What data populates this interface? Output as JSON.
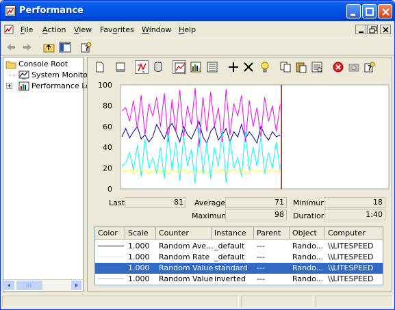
{
  "window": {
    "title": "Performance"
  },
  "menu": {
    "items": [
      {
        "key": "F",
        "rest": "ile"
      },
      {
        "key": "A",
        "rest": "ction"
      },
      {
        "key": "V",
        "rest": "iew"
      },
      {
        "pre": "Fav",
        "key": "o",
        "rest": "rites"
      },
      {
        "key": "W",
        "rest": "indow"
      },
      {
        "key": "H",
        "rest": "elp"
      }
    ]
  },
  "tree": {
    "root": "Console Root",
    "items": [
      "System Monitor",
      "Performance Lo"
    ]
  },
  "stats": {
    "last_label": "Last",
    "last_value": "81",
    "average_label": "Average",
    "average_value": "71",
    "minimum_label": "Minimum",
    "minimum_value": "18",
    "maximum_label": "Maximum",
    "maximum_value": "98",
    "duration_label": "Duration",
    "duration_value": "1:40"
  },
  "counters": {
    "columns": [
      "Color",
      "Scale",
      "Counter",
      "Instance",
      "Parent",
      "Object",
      "Computer"
    ],
    "rows": [
      {
        "color": "#0000a0",
        "scale": "1.000",
        "counter": "Random Ave...",
        "instance": "_default",
        "parent": "---",
        "object": "Rando...",
        "computer": "\\\\LITESPEED",
        "selected": false
      },
      {
        "color": "#ffff00",
        "scale": "1.000",
        "counter": "Random Rate",
        "instance": "_default",
        "parent": "---",
        "object": "Rando...",
        "computer": "\\\\LITESPEED",
        "selected": false
      },
      {
        "color": "#ff00ff",
        "scale": "1.000",
        "counter": "Random Value",
        "instance": "standard",
        "parent": "---",
        "object": "Rando...",
        "computer": "\\\\LITESPEED",
        "selected": true
      },
      {
        "color": "#00ffff",
        "scale": "1.000",
        "counter": "Random Value",
        "instance": "inverted",
        "parent": "---",
        "object": "Rando...",
        "computer": "\\\\LITESPEED",
        "selected": false
      }
    ]
  },
  "chart_data": {
    "type": "line",
    "ylim": [
      0,
      100
    ],
    "yticks": [
      "100",
      "80",
      "60",
      "40",
      "20",
      "0"
    ],
    "grid": false,
    "time_bar_fraction": 0.6,
    "series": [
      {
        "counter": "Random Ave...",
        "color": "#0000a0",
        "values": [
          50,
          58,
          49,
          55,
          60,
          48,
          52,
          45,
          50,
          62,
          55,
          48,
          58,
          63,
          55,
          45,
          60,
          52,
          48,
          56,
          65,
          50,
          44,
          55,
          60,
          47,
          52,
          58,
          45,
          55,
          50,
          62,
          48,
          55,
          50,
          44,
          60,
          52,
          47,
          55,
          50,
          52
        ]
      },
      {
        "counter": "Random Rate",
        "color": "#ffff00",
        "values": [
          18,
          16,
          19,
          15,
          18,
          16,
          18,
          15,
          17,
          19,
          16,
          18,
          15,
          18,
          17,
          16,
          19,
          15,
          17,
          18,
          16,
          18,
          15,
          17,
          18,
          16,
          19,
          15,
          17,
          18,
          16,
          18,
          15,
          17,
          18,
          16,
          18,
          15,
          17,
          18,
          16,
          17
        ]
      },
      {
        "counter": "Random Value",
        "instance": "standard",
        "color": "#ff00ff",
        "values": [
          75,
          78,
          65,
          85,
          58,
          90,
          52,
          82,
          70,
          88,
          60,
          92,
          45,
          86,
          55,
          95,
          50,
          80,
          62,
          97,
          40,
          88,
          55,
          93,
          60,
          78,
          45,
          96,
          52,
          82,
          70,
          90,
          45,
          85,
          60,
          78,
          50,
          88,
          65,
          80,
          55,
          81
        ]
      },
      {
        "counter": "Random Value",
        "instance": "inverted",
        "color": "#00ffff",
        "values": [
          22,
          25,
          35,
          18,
          42,
          12,
          48,
          20,
          30,
          15,
          40,
          10,
          55,
          18,
          45,
          8,
          50,
          22,
          38,
          5,
          60,
          15,
          45,
          10,
          40,
          22,
          55,
          6,
          48,
          20,
          30,
          12,
          55,
          18,
          40,
          22,
          50,
          15,
          35,
          20,
          45,
          18
        ]
      }
    ]
  }
}
